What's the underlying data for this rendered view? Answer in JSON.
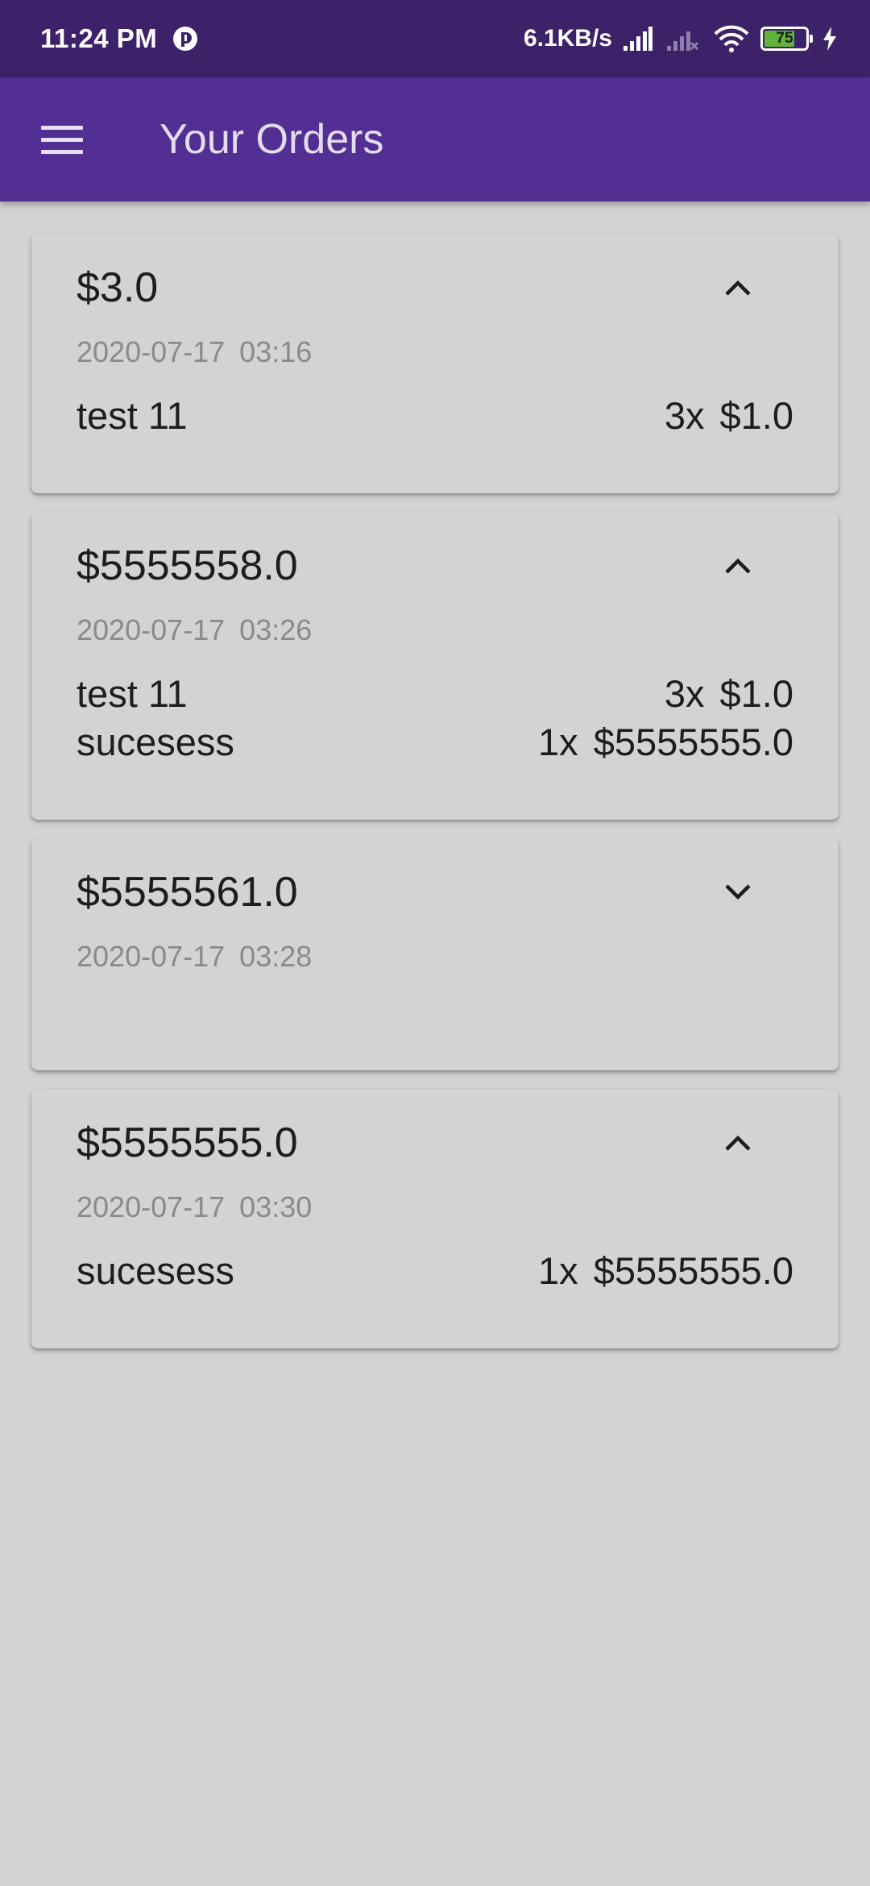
{
  "status_bar": {
    "time": "11:24 PM",
    "network_speed": "6.1KB/s",
    "battery_level": "75",
    "battery_fraction": 0.75,
    "icons": [
      "app-notification-icon",
      "signal-icon",
      "no-signal-icon",
      "wifi-icon",
      "battery-icon",
      "charging-icon"
    ]
  },
  "app_bar": {
    "title": "Your Orders",
    "menu_icon": "hamburger-menu-icon"
  },
  "colors": {
    "status_bar": "#3d2169",
    "app_bar": "#532e93",
    "background": "#d3d3d3",
    "primary_text": "#1d1d1d",
    "secondary_text": "#8a8a8a"
  },
  "orders": [
    {
      "total": "$3.0",
      "date": "2020-07-17",
      "time": "03:16",
      "expanded": true,
      "toggle_icon": "chevron-up-icon",
      "items": [
        {
          "name": "test 11",
          "qty": "3x",
          "price": "$1.0"
        }
      ]
    },
    {
      "total": "$5555558.0",
      "date": "2020-07-17",
      "time": "03:26",
      "expanded": true,
      "toggle_icon": "chevron-up-icon",
      "items": [
        {
          "name": "test 11",
          "qty": "3x",
          "price": "$1.0"
        },
        {
          "name": "sucesess",
          "qty": "1x",
          "price": "$5555555.0"
        }
      ]
    },
    {
      "total": "$5555561.0",
      "date": "2020-07-17",
      "time": "03:28",
      "expanded": false,
      "toggle_icon": "chevron-down-icon",
      "items": []
    },
    {
      "total": "$5555555.0",
      "date": "2020-07-17",
      "time": "03:30",
      "expanded": true,
      "toggle_icon": "chevron-up-icon",
      "items": [
        {
          "name": "sucesess",
          "qty": "1x",
          "price": "$5555555.0"
        }
      ]
    }
  ]
}
